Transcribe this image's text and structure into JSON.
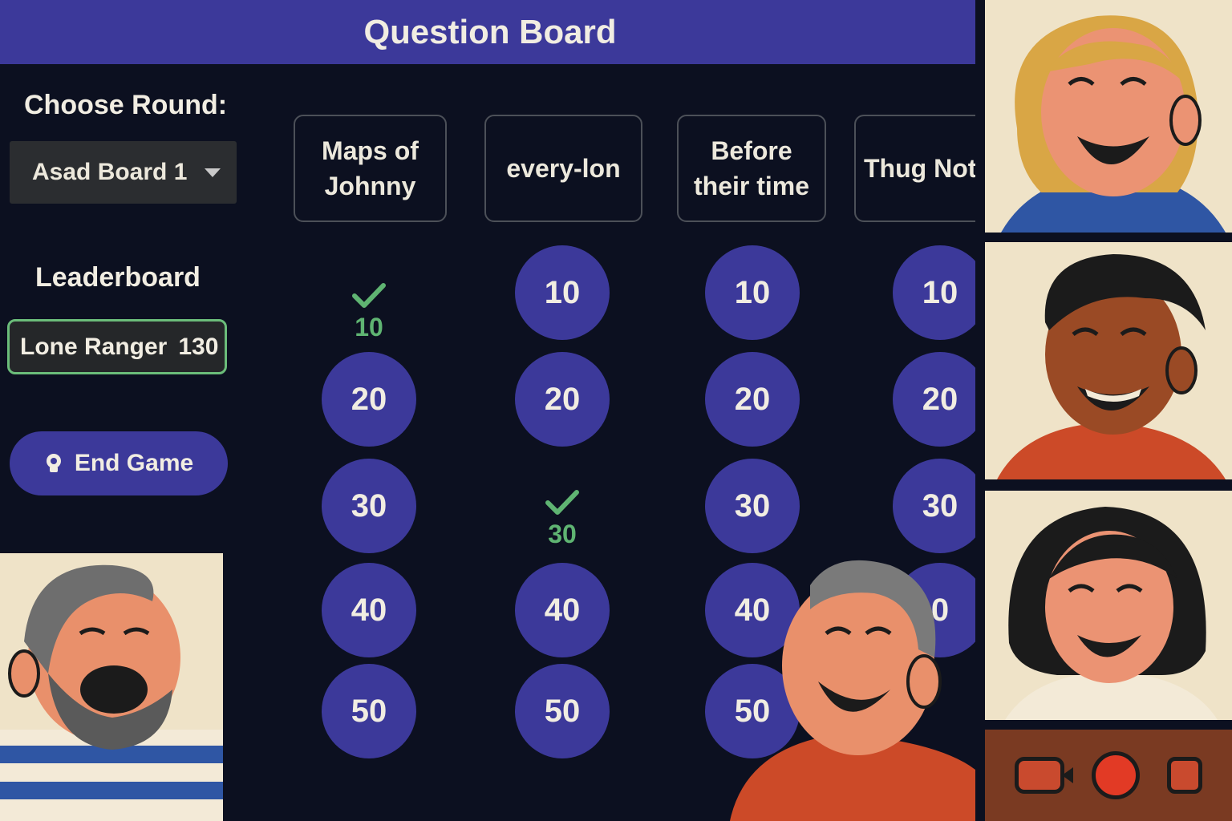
{
  "header": {
    "title": "Question Board"
  },
  "sidebar": {
    "round_label": "Choose Round:",
    "round_selected": "Asad Board 1",
    "leaderboard_label": "Leaderboard",
    "leaderboard": [
      {
        "name": "Lone Ranger",
        "score": "130"
      }
    ],
    "end_game_label": "End Game"
  },
  "board": {
    "categories": [
      {
        "line1": "Maps of",
        "line2": "Johnny"
      },
      {
        "line1": "every-lon",
        "line2": ""
      },
      {
        "line1": "Before",
        "line2": "their time"
      },
      {
        "line1": "Thug Not",
        "line2": ""
      }
    ],
    "columns": [
      [
        "10",
        "20",
        "30",
        "40",
        "50"
      ],
      [
        "10",
        "20",
        "30",
        "40",
        "50"
      ],
      [
        "10",
        "20",
        "30",
        "40",
        "50"
      ],
      [
        "10",
        "20",
        "30",
        "0",
        ""
      ]
    ],
    "answered": [
      {
        "col": 0,
        "row": 0
      },
      {
        "col": 1,
        "row": 2
      }
    ]
  },
  "colors": {
    "accent": "#3c399a",
    "answered": "#5fb472",
    "background": "#0c1020"
  },
  "icons": {
    "end_game": "lightbulb-icon",
    "answered": "checkmark-icon",
    "round_select": "chevron-down-icon"
  },
  "video_controls": [
    "camera-icon",
    "record-icon",
    "stop-icon"
  ]
}
